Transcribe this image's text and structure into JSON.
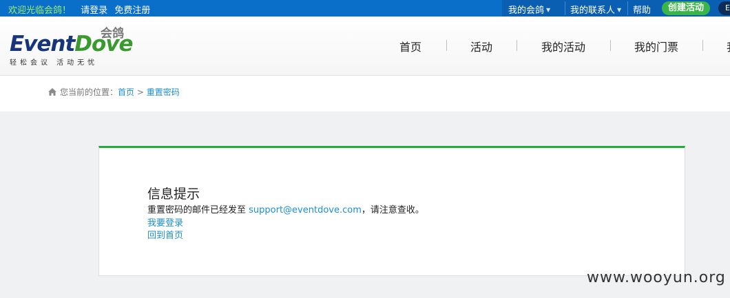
{
  "topbar": {
    "welcome": "欢迎光临会鸽！",
    "login": "请登录",
    "register": "免费注册",
    "my_huige": "我的会鸽",
    "my_contacts": "我的联系人",
    "help": "帮助",
    "create_event": "创建活动",
    "lang": "E"
  },
  "logo": {
    "brand_event": "Event",
    "brand_dove": "Dove",
    "cn_name": "会鸽",
    "slogan": "轻松会议 活动无忧"
  },
  "nav": {
    "items": [
      "首页",
      "活动",
      "我的活动",
      "我的门票",
      "我"
    ]
  },
  "breadcrumb": {
    "prefix": "您当前的位置：",
    "home": "首页",
    "sep": " > ",
    "current": "重置密码"
  },
  "panel": {
    "title": "信息提示",
    "msg_before": "重置密码的邮件已经发至 ",
    "email": "support@eventdove.com",
    "msg_after": "，请注意查收。",
    "link_login": "我要登录",
    "link_home": "回到首页"
  },
  "watermark": "www.wooyun.org",
  "colors": {
    "topbar": "#0a6fc9",
    "accent_green": "#22ad38",
    "link_blue": "#1a8fd6"
  }
}
